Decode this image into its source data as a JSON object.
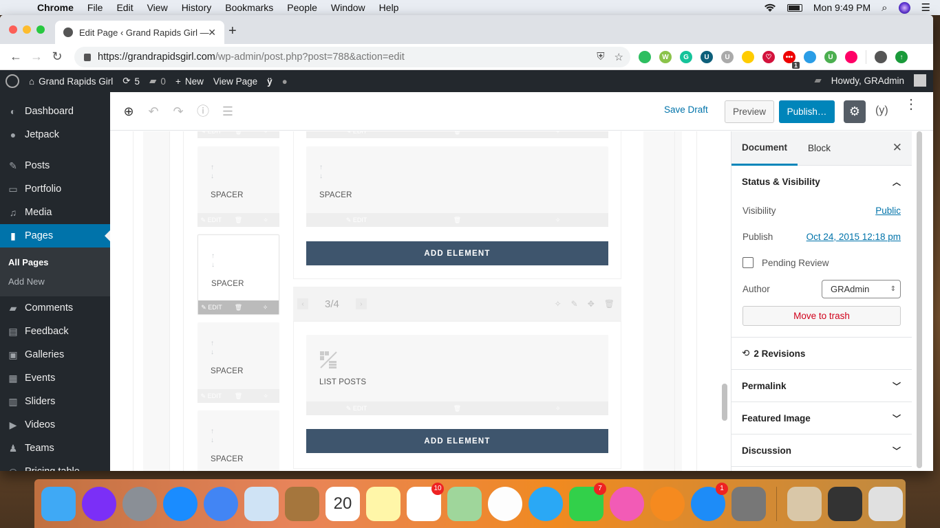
{
  "menubar": {
    "app": "Chrome",
    "items": [
      "File",
      "Edit",
      "View",
      "History",
      "Bookmarks",
      "People",
      "Window",
      "Help"
    ],
    "clock": "Mon 9:49 PM"
  },
  "browser": {
    "tab_title": "Edit Page ‹ Grand Rapids Girl —",
    "url_host": "https://grandrapidsgirl.com",
    "url_path": "/wp-admin/post.php?post=788&action=edit",
    "extensions": [
      {
        "name": "evernote",
        "color": "#2dbe60",
        "text": ""
      },
      {
        "name": "w-ext",
        "color": "#8bc34a",
        "text": "W"
      },
      {
        "name": "grammarly",
        "color": "#15c39a",
        "text": "G"
      },
      {
        "name": "u-ext-blue",
        "color": "#0d5f7a",
        "text": "U"
      },
      {
        "name": "u-ext-gray",
        "color": "#aaa",
        "text": "U"
      },
      {
        "name": "yellow-ext",
        "color": "#ffcc00",
        "text": ""
      },
      {
        "name": "pocket",
        "color": "#d3123c",
        "text": "♡"
      },
      {
        "name": "red-ext",
        "color": "#e00",
        "text": "•••",
        "badge": "1"
      },
      {
        "name": "blue-ext",
        "color": "#2a9de6",
        "text": ""
      },
      {
        "name": "green-u-ext",
        "color": "#4caf50",
        "text": "U"
      },
      {
        "name": "color-ext",
        "color": "#f06",
        "text": ""
      }
    ]
  },
  "adminbar": {
    "site_name": "Grand Rapids Girl",
    "updates": "5",
    "comments": "0",
    "new_label": "New",
    "view_page": "View Page",
    "howdy": "Howdy, GRAdmin"
  },
  "sidebar": {
    "items": [
      {
        "label": "Dashboard",
        "icon": "dashboard-icon",
        "glyph": "◐"
      },
      {
        "label": "Jetpack",
        "icon": "jetpack-icon",
        "glyph": "●"
      },
      {
        "label": "Posts",
        "icon": "pin-icon",
        "glyph": "✎"
      },
      {
        "label": "Portfolio",
        "icon": "portfolio-icon",
        "glyph": "▭"
      },
      {
        "label": "Media",
        "icon": "media-icon",
        "glyph": "♫"
      },
      {
        "label": "Pages",
        "icon": "pages-icon",
        "glyph": "▮"
      },
      {
        "label": "Comments",
        "icon": "comments-icon",
        "glyph": "▰"
      },
      {
        "label": "Feedback",
        "icon": "feedback-icon",
        "glyph": "▤"
      },
      {
        "label": "Galleries",
        "icon": "galleries-icon",
        "glyph": "▣"
      },
      {
        "label": "Events",
        "icon": "calendar-icon",
        "glyph": "▦"
      },
      {
        "label": "Sliders",
        "icon": "sliders-icon",
        "glyph": "▥"
      },
      {
        "label": "Videos",
        "icon": "video-icon",
        "glyph": "▶"
      },
      {
        "label": "Teams",
        "icon": "teams-icon",
        "glyph": "♟"
      },
      {
        "label": "Pricing table",
        "icon": "pricing-icon",
        "glyph": "◎"
      }
    ],
    "submenu": [
      "All Pages",
      "Add New"
    ]
  },
  "editor": {
    "save_draft": "Save Draft",
    "preview": "Preview",
    "publish": "Publish…"
  },
  "builder": {
    "spacer": "SPACER",
    "list_posts": "LIST POSTS",
    "edit": "EDIT",
    "add_element": "ADD ELEMENT",
    "pager": "3/4"
  },
  "settings": {
    "tab_document": "Document",
    "tab_block": "Block",
    "status_title": "Status & Visibility",
    "visibility_label": "Visibility",
    "visibility_value": "Public",
    "publish_label": "Publish",
    "publish_value": "Oct 24, 2015 12:18 pm",
    "pending_review": "Pending Review",
    "author_label": "Author",
    "author_value": "GRAdmin",
    "move_to_trash": "Move to trash",
    "revisions": "2 Revisions",
    "permalink": "Permalink",
    "featured_image": "Featured Image",
    "discussion": "Discussion"
  },
  "dock": {
    "apps": [
      {
        "name": "finder",
        "color": "#3fa9f5"
      },
      {
        "name": "siri",
        "color": "#7b2ff7"
      },
      {
        "name": "launchpad",
        "color": "#8a8f96"
      },
      {
        "name": "safari",
        "color": "#1a8cff"
      },
      {
        "name": "chrome",
        "color": "#4285f4"
      },
      {
        "name": "mail",
        "color": "#cfe3f5"
      },
      {
        "name": "contacts",
        "color": "#a5763d"
      },
      {
        "name": "calendar",
        "color": "#ffffff",
        "text": "20"
      },
      {
        "name": "notes",
        "color": "#fff6a8"
      },
      {
        "name": "reminders",
        "color": "#ffffff",
        "badge": "10"
      },
      {
        "name": "maps",
        "color": "#9fd69b"
      },
      {
        "name": "photos",
        "color": "#fdfdfd"
      },
      {
        "name": "messages",
        "color": "#2aa8f5"
      },
      {
        "name": "facetime",
        "color": "#32d04a",
        "badge": "7"
      },
      {
        "name": "itunes",
        "color": "#f25bb6"
      },
      {
        "name": "ibooks",
        "color": "#f58a1f"
      },
      {
        "name": "app-store",
        "color": "#1d8cf8",
        "badge": "1"
      },
      {
        "name": "system-preferences",
        "color": "#777"
      }
    ],
    "docs": [
      {
        "name": "photo-stack",
        "color": "#d9c7a8"
      },
      {
        "name": "chrome-window",
        "color": "#333"
      },
      {
        "name": "trash",
        "color": "#e0e0e0"
      }
    ]
  }
}
